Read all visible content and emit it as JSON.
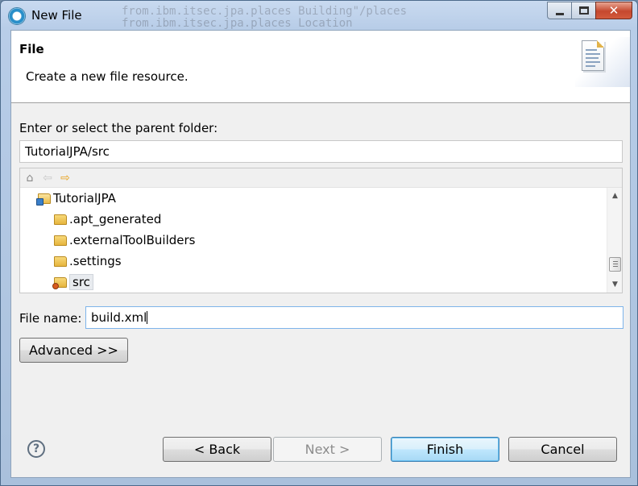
{
  "window": {
    "title": "New File",
    "background_text_1": "from.ibm.itsec.jpa.places Building\"/places",
    "background_text_2": "from.ibm.itsec.jpa.places Location"
  },
  "banner": {
    "title": "File",
    "description": "Create a new file resource."
  },
  "folder": {
    "label": "Enter or select the parent folder:",
    "value": "TutorialJPA/src"
  },
  "tree": {
    "items": [
      {
        "label": "TutorialJPA",
        "icon": "project-folder-icon"
      },
      {
        "label": ".apt_generated",
        "icon": "folder-icon"
      },
      {
        "label": ".externalToolBuilders",
        "icon": "folder-icon"
      },
      {
        "label": ".settings",
        "icon": "folder-icon"
      },
      {
        "label": "src",
        "icon": "source-folder-icon",
        "selected": true
      }
    ]
  },
  "file_name": {
    "label": "File name:",
    "value": "build.xml"
  },
  "buttons": {
    "advanced": "Advanced >>",
    "back": "< Back",
    "next": "Next >",
    "finish": "Finish",
    "cancel": "Cancel",
    "help": "?"
  },
  "colors": {
    "accent": "#3c7fb1",
    "dialog_bg": "#f0f0f0"
  }
}
